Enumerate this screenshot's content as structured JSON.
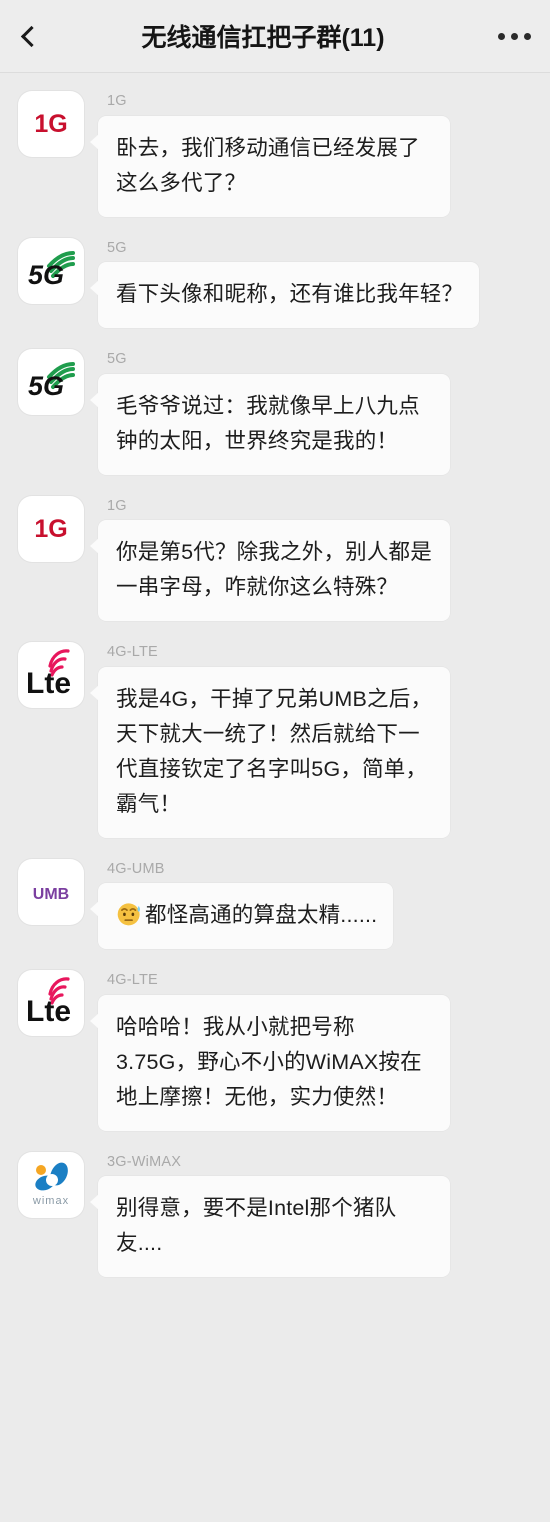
{
  "header": {
    "back_icon": "chevron-left-icon",
    "title": "无线通信扛把子群(11)",
    "more_icon": "more-dots-icon",
    "background_color": "#ededed"
  },
  "theme": {
    "page_background": "#ebebeb",
    "bubble_background": "#fbfbfb",
    "text_color": "#1d1d1d",
    "sender_name_color": "#a9a9a9",
    "avatar_background": "#ffffff",
    "accent_1g": "#c8102e",
    "accent_5g": "#1f9d4d",
    "accent_lte": "#e8175d",
    "accent_umb": "#7b3fa0",
    "accent_wimax": "#1b7fc4",
    "accent_wimax_dot": "#f5a623"
  },
  "messages": [
    {
      "sender": "1G",
      "avatar": "avatar-1g",
      "avatar_label": "1G",
      "text": "卧去，我们移动通信已经发展了这么多代了？",
      "emoji": ""
    },
    {
      "sender": "5G",
      "avatar": "avatar-5g",
      "avatar_label": "5G",
      "text": "看下头像和昵称，还有谁比我年轻？",
      "emoji": ""
    },
    {
      "sender": "5G",
      "avatar": "avatar-5g",
      "avatar_label": "5G",
      "text": "毛爷爷说过：我就像早上八九点钟的太阳，世界终究是我的！",
      "emoji": ""
    },
    {
      "sender": "1G",
      "avatar": "avatar-1g",
      "avatar_label": "1G",
      "text": "你是第5代？除我之外，别人都是一串字母，咋就你这么特殊？",
      "emoji": ""
    },
    {
      "sender": "4G-LTE",
      "avatar": "avatar-lte",
      "avatar_label": "Lte",
      "text": "我是4G，干掉了兄弟UMB之后，天下就大一统了！然后就给下一代直接钦定了名字叫5G，简单，霸气！",
      "emoji": ""
    },
    {
      "sender": "4G-UMB",
      "avatar": "avatar-umb",
      "avatar_label": "UMB",
      "text": "都怪高通的算盘太精......",
      "emoji": "awkward-sweat-face-emoji"
    },
    {
      "sender": "4G-LTE",
      "avatar": "avatar-lte",
      "avatar_label": "Lte",
      "text": "哈哈哈！我从小就把号称3.75G，野心不小的WiMAX按在地上摩擦！无他，实力使然！",
      "emoji": ""
    },
    {
      "sender": "3G-WiMAX",
      "avatar": "avatar-wimax",
      "avatar_label": "wimax",
      "text": "别得意，要不是Intel那个猪队友....",
      "emoji": ""
    }
  ]
}
